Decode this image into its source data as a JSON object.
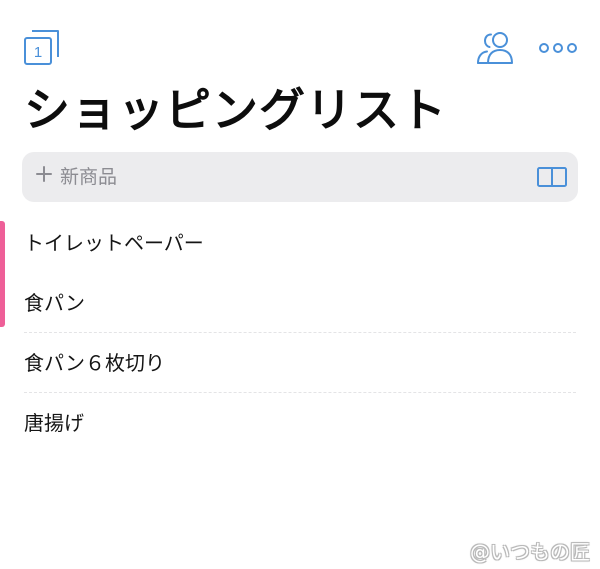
{
  "topbar": {
    "lists_badge_number": "1",
    "icons": {
      "lists": "stacked-lists-icon",
      "share": "people-icon",
      "more": "ellipsis-icon"
    }
  },
  "title": "ショッピングリスト",
  "new_item": {
    "placeholder": "新商品",
    "value": "",
    "icons": {
      "add": "plus-icon",
      "catalog": "open-book-icon"
    }
  },
  "items": [
    {
      "label": "トイレットペーパー"
    },
    {
      "label": "食パン"
    },
    {
      "label": "食パン６枚切り"
    },
    {
      "label": "唐揚げ"
    }
  ],
  "watermark": "@いつもの匠",
  "colors": {
    "accent": "#4a90d9",
    "selection_bar": "#ee5f98",
    "input_background": "#ececee",
    "placeholder": "#8c8c92"
  }
}
